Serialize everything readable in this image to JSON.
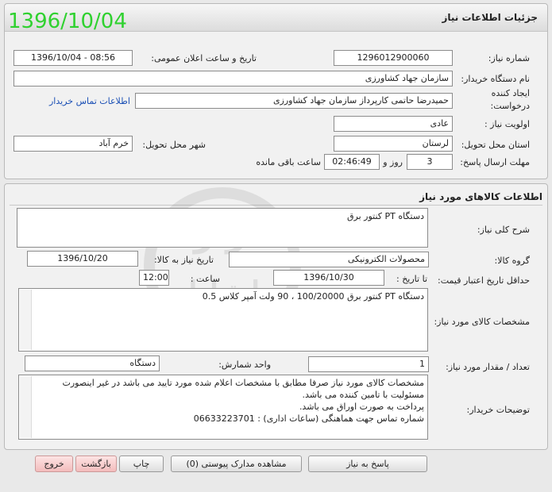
{
  "page_title": "جزئیات اطلاعات نیاز",
  "overlay_date": "1396/10/04",
  "info": {
    "need_number_label": "شماره نیاز:",
    "need_number": "1296012900060",
    "announce_label": "تاریخ و ساعت اعلان عمومی:",
    "announce_value": "1396/10/04 - 08:56",
    "buyer_label": "نام دستگاه خریدار:",
    "buyer_value": "سازمان جهاد کشاورزی",
    "creator_label": "ایجاد کننده درخواست:",
    "creator_value": "حمیدرضا حاتمی کارپرداز سازمان جهاد کشاورزی",
    "contact_link": "اطلاعات تماس خریدار",
    "priority_label": "اولویت نیاز :",
    "priority_value": "عادی",
    "province_label": "استان محل تحویل:",
    "province_value": "لرستان",
    "city_label": "شهر محل تحویل:",
    "city_value": "خرم آباد",
    "deadline_label": "مهلت ارسال پاسخ:",
    "deadline_days": "3",
    "days_word": "روز و",
    "deadline_time": "02:46:49",
    "remaining_word": "ساعت باقی مانده"
  },
  "goods": {
    "section_title": "اطلاعات کالاهای مورد نیاز",
    "desc_label": "شرح کلی نیاز:",
    "desc_value": "دستگاه PT کنتور برق",
    "group_label": "گروه کالا:",
    "group_value": "محصولات الکترونیکی",
    "need_date_label": "تاریخ نیاز به کالا:",
    "need_date_value": "1396/10/20",
    "min_valid_label": "حداقل تاریخ اعتبار قیمت:",
    "until_label": "تا تاریخ :",
    "until_value": "1396/10/30",
    "time_label": "ساعت :",
    "time_value": "12:00",
    "spec_label": "مشخصات کالای مورد نیاز:",
    "spec_value": "دستگاه PT کنتور برق 100/20000 ، 90 ولت آمپر کلاس 0.5",
    "qty_label": "تعداد / مقدار مورد نیاز:",
    "qty_value": "1",
    "unit_label": "واحد شمارش:",
    "unit_value": "دستگاه",
    "notes_label": "توضیحات خریدار:",
    "notes_lines": [
      "مشخصات کالای مورد نیاز صرفا مطابق با مشخصات اعلام شده مورد تایید می باشد در غیر اینصورت",
      "مسئولیت با تامین کننده می باشد.",
      "پرداخت به صورت اوراق می باشد.",
      "شماره تماس جهت هماهنگی (ساعات اداری) : 06633223701"
    ]
  },
  "buttons": {
    "reply": "پاسخ به نیاز",
    "attachments": "مشاهده مدارک پیوستی (0)",
    "print": "چاپ",
    "back": "بازگشت",
    "exit": "خروج"
  }
}
